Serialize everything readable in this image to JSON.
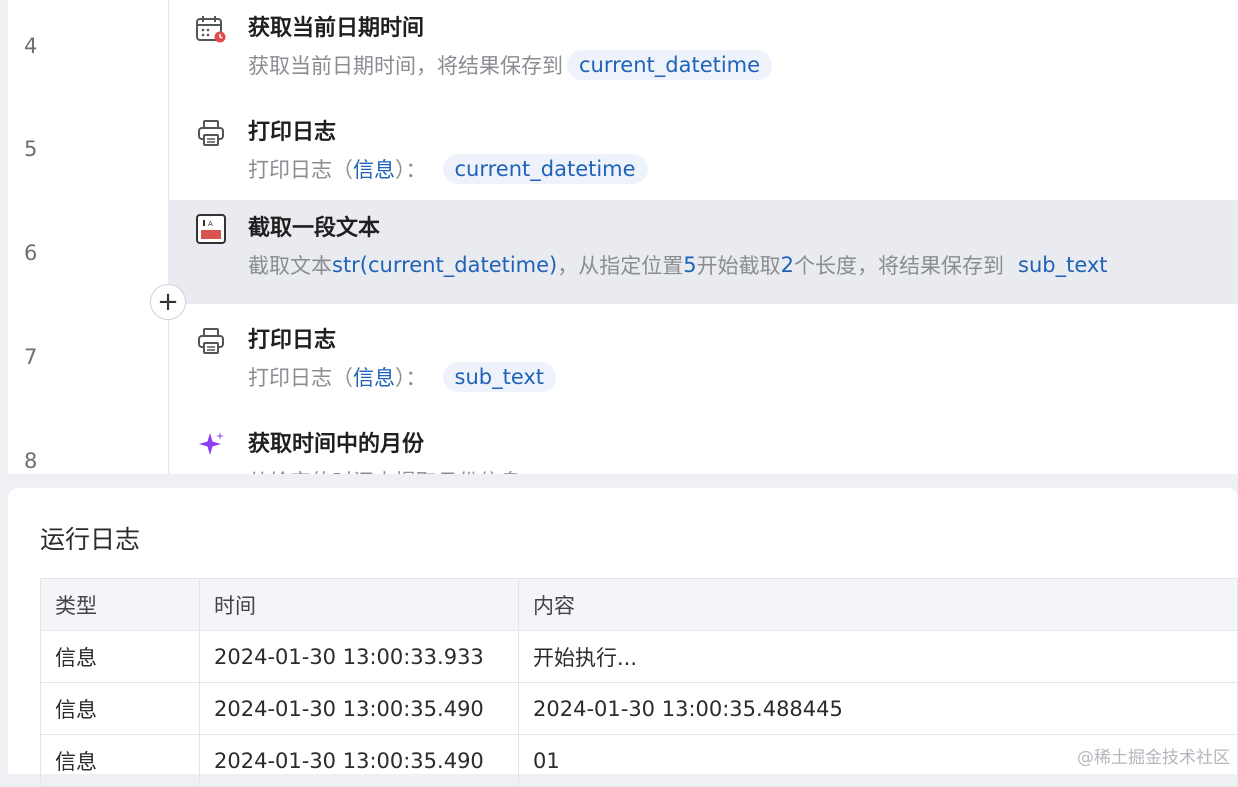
{
  "flow": {
    "line_numbers": [
      "4",
      "5",
      "6",
      "7",
      "8"
    ],
    "steps": [
      {
        "title": "获取当前日期时间",
        "icon": "calendar-icon",
        "desc_prefix": "获取当前日期时间，将结果保存到",
        "var": "current_datetime"
      },
      {
        "title": "打印日志",
        "icon": "printer-icon",
        "desc_prefix": "打印日志（",
        "desc_level": "信息",
        "desc_suffix": "）：",
        "var": "current_datetime"
      },
      {
        "title": "截取一段文本",
        "icon": "text-cut-icon",
        "desc_a": "截取文本",
        "desc_expr": "str(current_datetime)",
        "desc_b": "，从指定位置",
        "desc_pos": "5",
        "desc_c": "开始截取",
        "desc_len": "2",
        "desc_d": "个长度，将结果保存到",
        "var": "sub_text"
      },
      {
        "title": "打印日志",
        "icon": "printer-icon",
        "desc_prefix": "打印日志（",
        "desc_level": "信息",
        "desc_suffix": "）：",
        "var": "sub_text"
      },
      {
        "title": "获取时间中的月份",
        "icon": "sparkle-icon",
        "desc_prefix": "从给定的时间中提取月份信息"
      }
    ],
    "add_label": "+"
  },
  "log": {
    "title": "运行日志",
    "columns": [
      "类型",
      "时间",
      "内容"
    ],
    "rows": [
      [
        "信息",
        "2024-01-30 13:00:33.933",
        "开始执行..."
      ],
      [
        "信息",
        "2024-01-30 13:00:35.490",
        "2024-01-30 13:00:35.488445"
      ],
      [
        "信息",
        "2024-01-30 13:00:35.490",
        "01"
      ]
    ]
  },
  "watermark": "@稀土掘金技术社区",
  "colors": {
    "accent": "#1f62b8",
    "chip_bg": "#eef3fb",
    "selected_bg": "#e9ebf0",
    "sparkle": "#8a3ff0"
  }
}
